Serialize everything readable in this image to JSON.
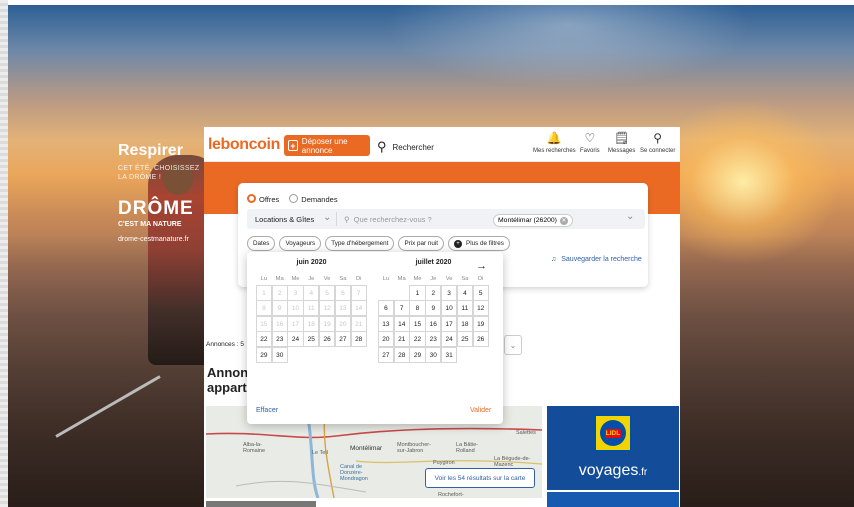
{
  "background_ad": {
    "title": "Respirer",
    "tagline": "CET ÉTÉ, CHOISISSEZ\nLA DRÔME !",
    "brand": "DRÔME",
    "brand_sub": "C'EST MA NATURE",
    "url": "drome-cestmanature.fr"
  },
  "header": {
    "logo": "leboncoin",
    "deposer": "Déposer une annonce",
    "rechercher": "Rechercher",
    "nav": [
      {
        "icon": "bell-icon",
        "glyph": "🔔",
        "label": "Mes recherches"
      },
      {
        "icon": "heart-icon",
        "glyph": "♡",
        "label": "Favoris"
      },
      {
        "icon": "message-icon",
        "glyph": "🗒",
        "label": "Messages"
      },
      {
        "icon": "user-icon",
        "glyph": "⚲",
        "label": "Se connecter"
      }
    ]
  },
  "search": {
    "offres": "Offres",
    "demandes": "Demandes",
    "category": "Locations & Gîtes",
    "query_placeholder": "Que recherchez-vous ?",
    "location": "Montélimar (26200)",
    "filters": [
      "Dates",
      "Voyageurs",
      "Type d'hébergement",
      "Prix par nuit"
    ],
    "more_filters": "Plus de filtres",
    "save": "Sauvegarder la recherche"
  },
  "results": {
    "count_prefix": "Annonces : 5",
    "heading": "Annonces appartements",
    "map_button": "Voir les 54 résultats sur la carte",
    "map_labels": [
      "Alba-la-Romaine",
      "Le Teil",
      "Montélimar",
      "Montboucher-sur-Jabron",
      "La Bâtie-Rolland",
      "Puygiron",
      "La Bégude-de-Mazenc",
      "Canal de Donzère-Mondragon",
      "Salettes",
      "Rochefort-"
    ]
  },
  "ad": {
    "brand": "LIDL",
    "voyages": "voyages",
    "tld": ".fr"
  },
  "calendar": {
    "weekdays": [
      "Lu",
      "Ma",
      "Me",
      "Je",
      "Ve",
      "Sa",
      "Di"
    ],
    "months": [
      {
        "title": "juin 2020",
        "offset": 0,
        "days": 30,
        "disabled_until": 21
      },
      {
        "title": "juillet 2020",
        "offset": 2,
        "days": 31,
        "disabled_until": 0
      }
    ],
    "effacer": "Effacer",
    "valider": "Valider"
  },
  "colors": {
    "accent": "#ea6a24",
    "link": "#2e5fa8"
  }
}
